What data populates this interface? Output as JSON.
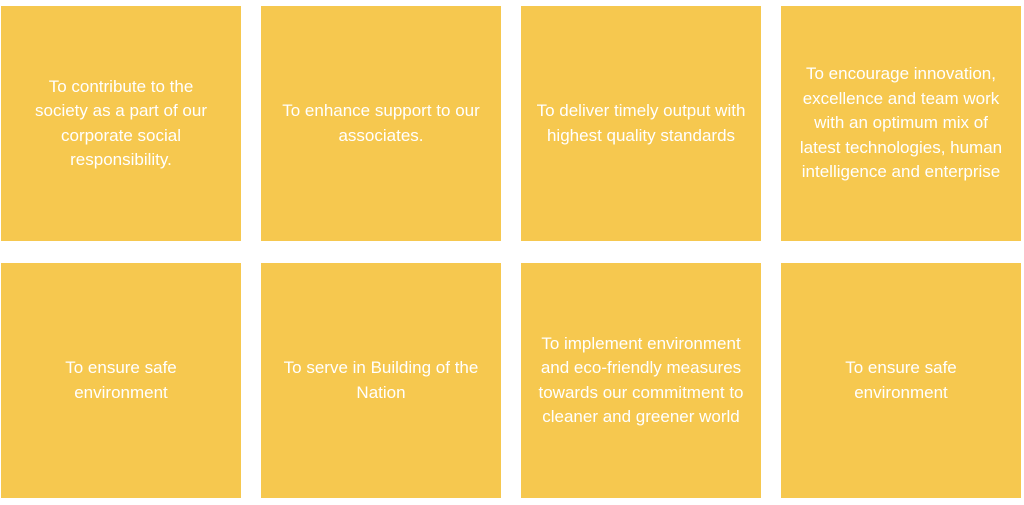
{
  "tiles": [
    {
      "text": "To contribute to the society as a part of our corporate social responsibility."
    },
    {
      "text": "To enhance support to our associates."
    },
    {
      "text": "To deliver timely output with highest quality standards"
    },
    {
      "text": "To encourage innovation, excellence and team work with an optimum mix of latest technologies, human intelligence and enterprise"
    },
    {
      "text": "To ensure safe environment"
    },
    {
      "text": "To serve in Building of the Nation"
    },
    {
      "text": "To implement environment and eco-friendly measures towards our commitment to cleaner and greener world"
    },
    {
      "text": "To ensure safe environment"
    }
  ],
  "colors": {
    "tile_background": "#f6c84f",
    "tile_text": "#ffffff",
    "page_background": "#ffffff"
  }
}
